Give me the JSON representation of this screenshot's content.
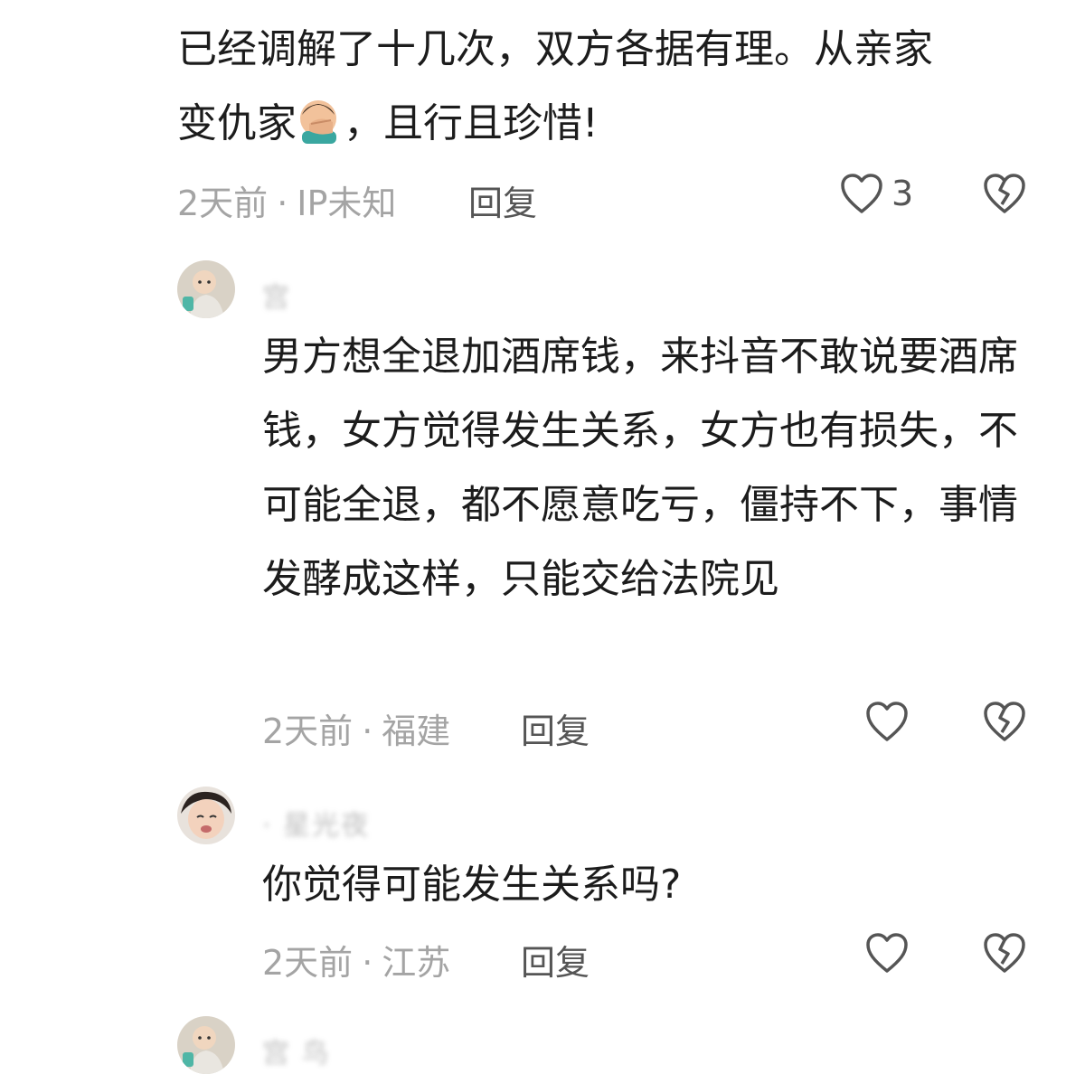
{
  "comments": [
    {
      "text_line1": "已经调解了十几次，双方各据有理。从亲家",
      "text_line2_a": "变仇家",
      "text_line2_b": "，且行且珍惜!",
      "emoji": "facepalm-man-icon",
      "time": "2天前",
      "location": "IP未知",
      "reply": "回复",
      "likes": "3"
    },
    {
      "username": "  宫",
      "text": "男方想全退加酒席钱，来抖音不敢说要酒席钱，女方觉得发生关系，女方也有损失，不可能全退，都不愿意吃亏，僵持不下，事情发酵成这样，只能交给法院见",
      "time": "2天前",
      "location": "福建",
      "reply": "回复",
      "likes": ""
    },
    {
      "username": "   ·        星光夜",
      "text": "你觉得可能发生关系吗?",
      "time": "2天前",
      "location": "江苏",
      "reply": "回复",
      "likes": ""
    },
    {
      "username": "   宫        鸟",
      "text": "",
      "time": "",
      "location": "",
      "reply": "",
      "likes": ""
    }
  ],
  "separator": "·",
  "icons": {
    "like": "heart-outline-icon",
    "dislike": "broken-heart-icon"
  },
  "colors": {
    "text": "#1c1c1c",
    "meta": "#a4a4a4",
    "action": "#555555"
  }
}
